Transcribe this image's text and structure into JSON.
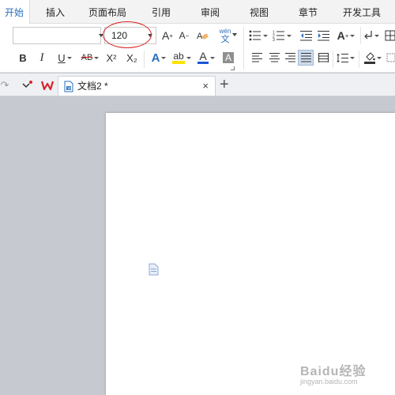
{
  "menu": {
    "tabs": [
      "开始",
      "插入",
      "页面布局",
      "引用",
      "审阅",
      "视图",
      "章节",
      "开发工具"
    ],
    "active_index": 0
  },
  "ribbon": {
    "font_name_value": "",
    "font_size_value": "120",
    "pinyin_label": "wén",
    "pinyin_char": "文",
    "bold": "B",
    "italic": "I",
    "underline": "U",
    "strikethrough": "AB",
    "superscript": "X²",
    "subscript": "X₂",
    "effects": "A",
    "highlight": "ab",
    "font_color": "A",
    "shading": "A",
    "grow_font": "A",
    "shrink_font": "A"
  },
  "tabbar": {
    "doc_title": "文档2 *",
    "close_label": "×",
    "new_tab_label": "+"
  },
  "watermark": {
    "brand": "Baidu经验",
    "sub": "jingyan.baidu.com"
  },
  "colors": {
    "active_tab_text": "#2a6ebb",
    "highlight_yellow": "#ffe100",
    "font_color_red": "#e02020",
    "font_color_blue": "#1a56d6",
    "annotation_red": "#d61f1f",
    "wps_logo_red": "#d8262b"
  }
}
